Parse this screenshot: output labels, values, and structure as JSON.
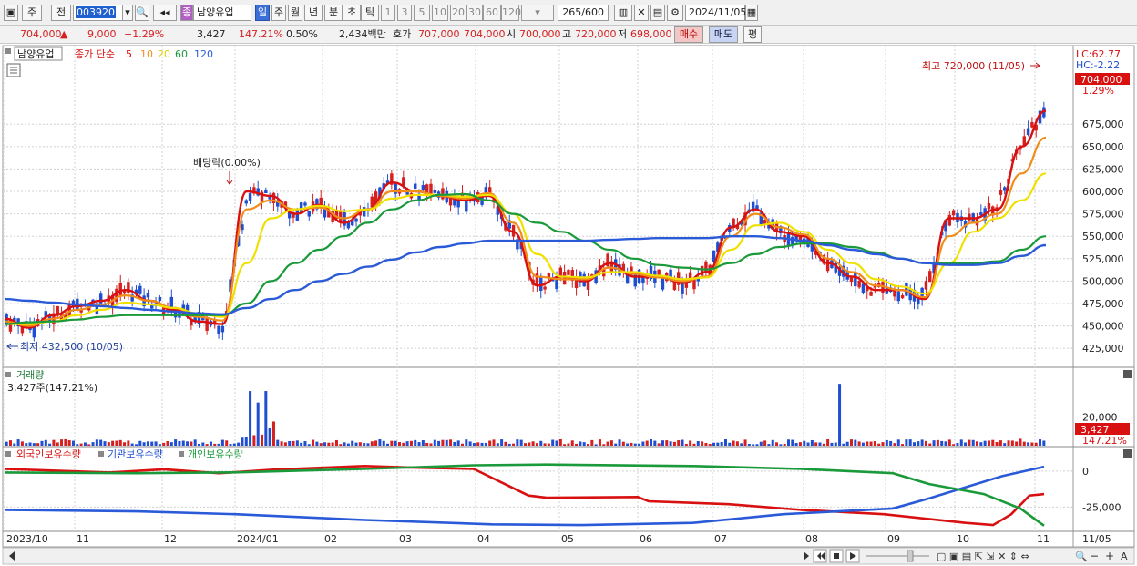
{
  "toolbar": {
    "period_mode": "주",
    "prev_label": "전",
    "code": "003920",
    "stock_badge": "종",
    "stock_name": "남양유업",
    "timeframes": [
      "일",
      "주",
      "월",
      "년",
      "분",
      "초",
      "틱"
    ],
    "intervals": [
      "1",
      "3",
      "5",
      "10",
      "20",
      "30",
      "60",
      "120"
    ],
    "count": "265",
    "count_total": "/600",
    "date": "2024/11/05"
  },
  "quote": {
    "price": "704,000",
    "change_arrow": "▲",
    "change": "9,000",
    "change_pct": "+1.29%",
    "volume": "3,427",
    "volume_ratio": "147.21%",
    "turnover": "0.50%",
    "amount": "2,434백만",
    "ask_label": "호가",
    "ask": "707,000",
    "bid": "704,000",
    "open_label": "시",
    "open": "700,000",
    "high_label": "고",
    "high": "720,000",
    "low_label": "저",
    "low": "698,000",
    "buy_label": "매수",
    "sell_label": "매도",
    "eval_label": "평"
  },
  "price_panel": {
    "name": "남양유업",
    "ma_title": "종가 단순",
    "ma_periods": [
      "5",
      "10",
      "20",
      "60",
      "120"
    ],
    "lc": "LC:62.77",
    "hc": "HC:-2.22",
    "current": "704,000",
    "current_pct": "1.29%",
    "high_annot": "최고 720,000 (11/05)",
    "low_annot": "최저 432,500 (10/05)",
    "dividend_annot": "배당락(0.00%)"
  },
  "volume_panel": {
    "title": "거래량",
    "value": "3,427주(147.21%)",
    "current": "3,427",
    "current_pct": "147.21%"
  },
  "holdings_panel": {
    "titles": [
      "외국인보유수량",
      "기관보유수량",
      "개인보유수량"
    ]
  },
  "colors": {
    "up": "#d61f1f",
    "down": "#1f4fd0",
    "ma5": "#d81010",
    "ma10": "#f08c1a",
    "ma20": "#f0e000",
    "ma60": "#1a9a3a",
    "ma120": "#2a5ad8"
  },
  "chart_data": {
    "type": "candlestick",
    "x_labels": [
      "2023/10",
      "11",
      "12",
      "2024/01",
      "02",
      "03",
      "04",
      "05",
      "06",
      "07",
      "08",
      "09",
      "10",
      "11",
      "11/05"
    ],
    "y_ticks": [
      "425,000",
      "450,000",
      "475,000",
      "500,000",
      "525,000",
      "550,000",
      "575,000",
      "600,000",
      "625,000",
      "650,000",
      "675,000"
    ],
    "ylim": [
      415000,
      722000
    ],
    "series": [
      {
        "name": "5",
        "values": [
          458000,
          448000,
          462000,
          472000,
          478000,
          490000,
          478000,
          468000,
          455000,
          452000,
          600000,
          595000,
          575000,
          585000,
          565000,
          580000,
          610000,
          600000,
          595000,
          590000,
          595000,
          555000,
          495000,
          505000,
          500000,
          520000,
          505000,
          505000,
          498000,
          510000,
          560000,
          580000,
          555000,
          550000,
          520000,
          505000,
          490000,
          490000,
          480000,
          570000,
          570000,
          580000,
          650000,
          690000
        ]
      },
      {
        "name": "10",
        "values": [
          455000,
          450000,
          458000,
          468000,
          474000,
          484000,
          478000,
          470000,
          460000,
          456000,
          580000,
          590000,
          580000,
          582000,
          570000,
          580000,
          600000,
          600000,
          595000,
          592000,
          598000,
          565000,
          505000,
          502000,
          502000,
          515000,
          508000,
          504000,
          500000,
          505000,
          550000,
          575000,
          560000,
          552000,
          525000,
          510000,
          495000,
          490000,
          482000,
          550000,
          565000,
          575000,
          620000,
          660000
        ]
      },
      {
        "name": "20",
        "values": [
          452000,
          452000,
          455000,
          462000,
          468000,
          476000,
          474000,
          470000,
          464000,
          460000,
          520000,
          570000,
          580000,
          584000,
          578000,
          580000,
          592000,
          596000,
          596000,
          594000,
          596000,
          575000,
          530000,
          505000,
          504000,
          510000,
          510000,
          506000,
          502000,
          504000,
          535000,
          562000,
          565000,
          555000,
          535000,
          520000,
          502000,
          494000,
          486000,
          520000,
          555000,
          570000,
          590000,
          620000
        ]
      },
      {
        "name": "60",
        "values": [
          452000,
          454000,
          455000,
          457000,
          460000,
          462000,
          462000,
          462000,
          462000,
          462000,
          475000,
          500000,
          520000,
          535000,
          550000,
          565000,
          580000,
          590000,
          596000,
          597000,
          590000,
          575000,
          565000,
          555000,
          545000,
          535000,
          525000,
          518000,
          515000,
          513000,
          520000,
          530000,
          538000,
          542000,
          542000,
          538000,
          532000,
          525000,
          520000,
          520000,
          520000,
          522000,
          535000,
          550000
        ]
      },
      {
        "name": "120",
        "values": [
          480000,
          478000,
          476000,
          474000,
          472000,
          470000,
          468000,
          466000,
          464000,
          463000,
          470000,
          480000,
          490000,
          500000,
          508000,
          516000,
          524000,
          532000,
          538000,
          542000,
          545000,
          545000,
          545000,
          545000,
          545000,
          546000,
          547000,
          548000,
          548000,
          548000,
          550000,
          550000,
          548000,
          545000,
          540000,
          535000,
          530000,
          525000,
          520000,
          518000,
          518000,
          520000,
          528000,
          540000
        ]
      }
    ],
    "volume": {
      "ticks": [
        "20,000"
      ],
      "ylim": [
        0,
        45000
      ]
    },
    "holdings": {
      "ticks": [
        "0",
        "-25,000"
      ],
      "ylim": [
        -40000,
        7500
      ]
    }
  }
}
